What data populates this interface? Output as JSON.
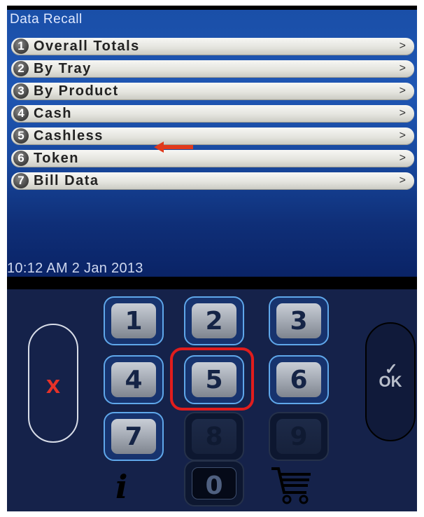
{
  "screen": {
    "title": "Data Recall",
    "menu": [
      {
        "num": "1",
        "label": "Overall Totals",
        "chevron": ">"
      },
      {
        "num": "2",
        "label": "By Tray",
        "chevron": ">"
      },
      {
        "num": "3",
        "label": "By Product",
        "chevron": ">"
      },
      {
        "num": "4",
        "label": "Cash",
        "chevron": ">"
      },
      {
        "num": "5",
        "label": "Cashless",
        "chevron": ">"
      },
      {
        "num": "6",
        "label": "Token",
        "chevron": ">"
      },
      {
        "num": "7",
        "label": "Bill Data",
        "chevron": ">"
      }
    ],
    "datetime": "10:12 AM 2 Jan 2013"
  },
  "keypad": {
    "keys": [
      "1",
      "2",
      "3",
      "4",
      "5",
      "6",
      "7",
      "8",
      "9",
      "0"
    ],
    "cancel_symbol": "x",
    "ok_label": "OK",
    "ok_check": "✓",
    "info_symbol": "i"
  },
  "colors": {
    "highlight": "#e01d1d",
    "annotation_arrow": "#e03a1c",
    "cancel_x": "#e63228"
  },
  "icons": [
    "cancel-x-icon",
    "ok-check-icon",
    "info-icon",
    "shopping-cart-icon",
    "annotation-arrow-icon"
  ]
}
